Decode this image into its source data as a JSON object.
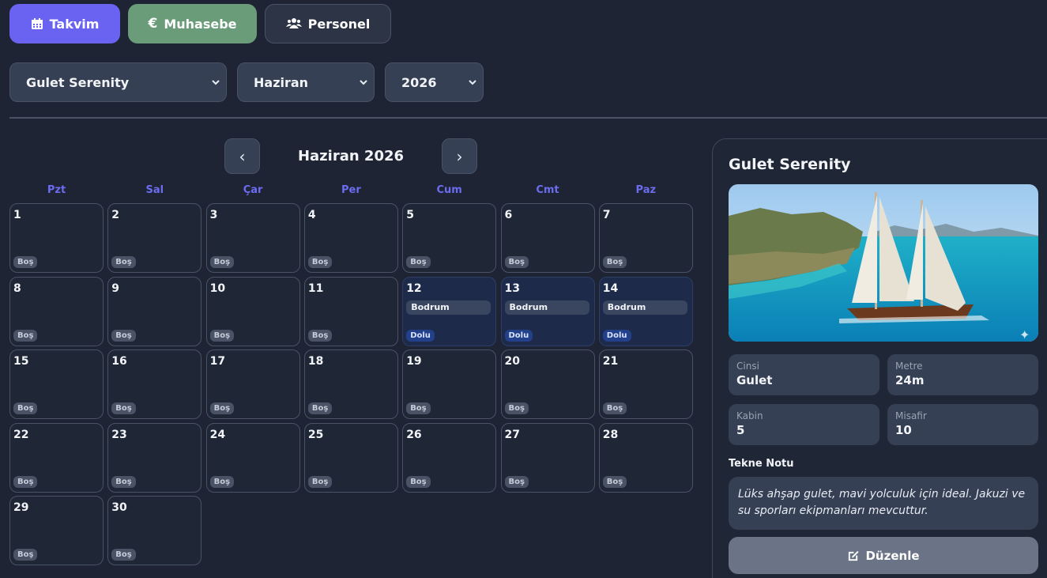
{
  "nav": {
    "takvim": "Takvim",
    "muhasebe": "Muhasebe",
    "personel": "Personel"
  },
  "filters": {
    "boat": "Gulet Serenity",
    "month": "Haziran",
    "year": "2026"
  },
  "calendar": {
    "title": "Haziran 2026",
    "prev": "‹",
    "next": "›",
    "weekdays": [
      "Pzt",
      "Sal",
      "Çar",
      "Per",
      "Cum",
      "Cmt",
      "Paz"
    ],
    "days": [
      {
        "n": "1",
        "s": "Boş"
      },
      {
        "n": "2",
        "s": "Boş"
      },
      {
        "n": "3",
        "s": "Boş"
      },
      {
        "n": "4",
        "s": "Boş"
      },
      {
        "n": "5",
        "s": "Boş"
      },
      {
        "n": "6",
        "s": "Boş"
      },
      {
        "n": "7",
        "s": "Boş"
      },
      {
        "n": "8",
        "s": "Boş"
      },
      {
        "n": "9",
        "s": "Boş"
      },
      {
        "n": "10",
        "s": "Boş"
      },
      {
        "n": "11",
        "s": "Boş"
      },
      {
        "n": "12",
        "s": "Dolu",
        "loc": "Bodrum"
      },
      {
        "n": "13",
        "s": "Dolu",
        "loc": "Bodrum"
      },
      {
        "n": "14",
        "s": "Dolu",
        "loc": "Bodrum"
      },
      {
        "n": "15",
        "s": "Boş"
      },
      {
        "n": "16",
        "s": "Boş"
      },
      {
        "n": "17",
        "s": "Boş"
      },
      {
        "n": "18",
        "s": "Boş"
      },
      {
        "n": "19",
        "s": "Boş"
      },
      {
        "n": "20",
        "s": "Boş"
      },
      {
        "n": "21",
        "s": "Boş"
      },
      {
        "n": "22",
        "s": "Boş"
      },
      {
        "n": "23",
        "s": "Boş"
      },
      {
        "n": "24",
        "s": "Boş"
      },
      {
        "n": "25",
        "s": "Boş"
      },
      {
        "n": "26",
        "s": "Boş"
      },
      {
        "n": "27",
        "s": "Boş"
      },
      {
        "n": "28",
        "s": "Boş"
      },
      {
        "n": "29",
        "s": "Boş"
      },
      {
        "n": "30",
        "s": "Boş"
      }
    ]
  },
  "panel": {
    "name": "Gulet Serenity",
    "cinsi_label": "Cinsi",
    "cinsi": "Gulet",
    "metre_label": "Metre",
    "metre": "24m",
    "kabin_label": "Kabin",
    "kabin": "5",
    "misafir_label": "Misafir",
    "misafir": "10",
    "notes_title": "Tekne Notu",
    "notes": "Lüks ahşap gulet, mavi yolculuk için ideal. Jakuzi ve su sporları ekipmanları mevcuttur.",
    "edit": "Düzenle"
  },
  "icons": {
    "takvim": "calendar-icon",
    "muhasebe": "euro-icon",
    "personel": "users-icon",
    "edit": "edit-icon"
  },
  "colors": {
    "accent": "#6a63f2",
    "muhasebe": "#6b9c7a",
    "booked": "#1d2a4a"
  }
}
